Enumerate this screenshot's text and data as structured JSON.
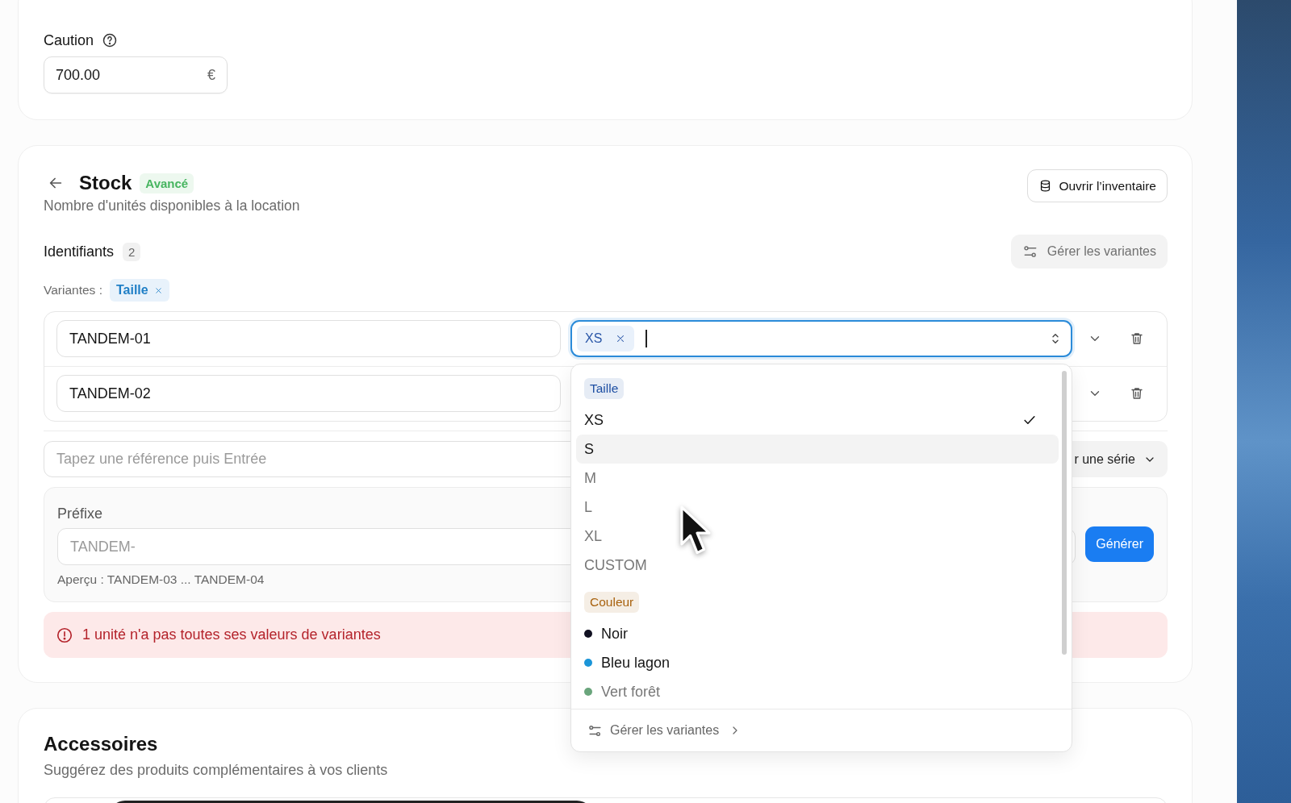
{
  "caution": {
    "label": "Caution",
    "value": "700.00",
    "suffix": "€"
  },
  "stock": {
    "title": "Stock",
    "badge": "Avancé",
    "subtitle": "Nombre d'unités disponibles à la location",
    "open_inventory_button": "Ouvrir l’inventaire",
    "identifiers": {
      "label": "Identifiants",
      "count": "2",
      "manage_button": "Gérer les variantes"
    },
    "variants": {
      "label": "Variantes :",
      "tags": [
        {
          "label": "Taille"
        }
      ]
    },
    "units": [
      {
        "reference": "TANDEM-01",
        "focused": true,
        "values": [
          {
            "label": "XS"
          }
        ]
      },
      {
        "reference": "TANDEM-02",
        "focused": false
      }
    ],
    "reference_input": {
      "placeholder": "Tapez une référence puis Entrée"
    },
    "series_button": "r une série",
    "prefix": {
      "label": "Préfixe",
      "placeholder": "TANDEM-",
      "preview": "Aperçu : TANDEM-03 ... TANDEM-04",
      "generate_button": "Générer"
    },
    "error": "1 unité n'a pas toutes ses valeurs de variantes"
  },
  "dropdown": {
    "groups": [
      {
        "label": "Taille",
        "color": "#1e4fa3",
        "options": [
          {
            "label": "XS",
            "selected": true,
            "highlighted": false,
            "faded": false
          },
          {
            "label": "S",
            "selected": false,
            "highlighted": true,
            "faded": false
          },
          {
            "label": "M",
            "selected": false,
            "highlighted": false,
            "faded": true
          },
          {
            "label": "L",
            "selected": false,
            "highlighted": false,
            "faded": true
          },
          {
            "label": "XL",
            "selected": false,
            "highlighted": false,
            "faded": true
          },
          {
            "label": "CUSTOM",
            "selected": false,
            "highlighted": false,
            "faded": true
          }
        ]
      },
      {
        "label": "Couleur",
        "color": "#a8620f",
        "options": [
          {
            "label": "Noir",
            "selected": false,
            "highlighted": false,
            "faded": false,
            "color": "#111122"
          },
          {
            "label": "Bleu lagon",
            "selected": false,
            "highlighted": false,
            "faded": false,
            "color": "#1b95d8"
          },
          {
            "label": "Vert forêt",
            "selected": false,
            "highlighted": false,
            "faded": true,
            "color": "#6aa57c"
          }
        ]
      }
    ],
    "footer_link": "Gérer les variantes"
  },
  "accessories": {
    "title": "Accessoires",
    "subtitle": "Suggérez des produits complémentaires à vos clients"
  }
}
